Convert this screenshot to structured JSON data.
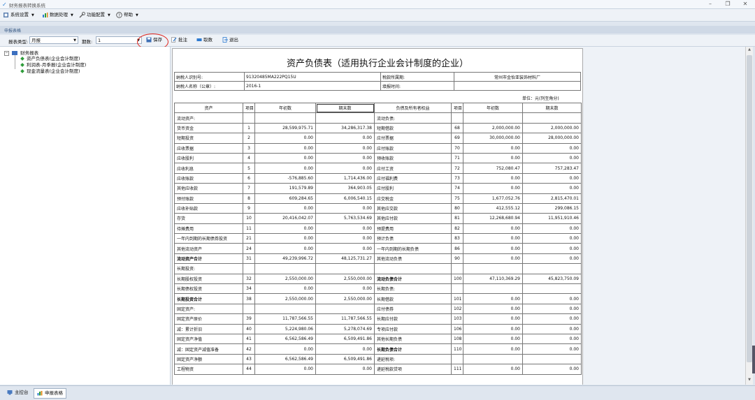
{
  "window": {
    "title": "财务报表转换系统"
  },
  "menu": [
    {
      "label": "系统设置",
      "icon": "settings-icon"
    },
    {
      "label": "数据处理",
      "icon": "data-icon"
    },
    {
      "label": "功能配置",
      "icon": "tools-icon"
    },
    {
      "label": "帮助",
      "icon": "help-icon"
    }
  ],
  "tab_strip": {
    "label": "申报表格"
  },
  "toolbar": {
    "report_type_label": "报表类型:",
    "report_type_value": "月报",
    "period_label": "期数:",
    "period_value": "1",
    "save_label": "保存",
    "annotate_label": "批注",
    "fetch_label": "取数",
    "exit_label": "退出"
  },
  "tree": {
    "root": "财务报表",
    "items": [
      "资产负债表(企业会计制度)",
      "利润表-月季报(企业会计制度)",
      "现金流量表(企业会计制度)"
    ]
  },
  "sheet": {
    "title": "资产负债表（适用执行企业会计制度的企业）",
    "taxpayer_id_label": "纳税人识别号:",
    "taxpayer_id": "91320485MA222PQ15U",
    "tax_office_label": "税款所属期:",
    "tax_office_value": "常州市金怡亚装饰材料厂",
    "taxpayer_name_label": "纳税人名称（公章）:",
    "taxpayer_name": "2016-1",
    "fill_date_label": "填报时间:",
    "unit": "单位：元(列至角分)",
    "headers": [
      "资产",
      "项目",
      "年初数",
      "期末数",
      "负债及所有者权益",
      "项目",
      "年初数",
      "期末数"
    ],
    "rows": [
      [
        "流动资产:",
        "",
        "",
        "",
        "流动负债:",
        "",
        "",
        ""
      ],
      [
        "货币资金",
        "1",
        "28,599,975.71",
        "34,286,317.38",
        "短期借款",
        "68",
        "2,000,000.00",
        "2,000,000.00"
      ],
      [
        "短期投资",
        "2",
        "0.00",
        "0.00",
        "应付票据",
        "69",
        "30,000,000.00",
        "28,000,000.00"
      ],
      [
        "应收票据",
        "3",
        "0.00",
        "0.00",
        "应付账款",
        "70",
        "0.00",
        "0.00"
      ],
      [
        "应收股利",
        "4",
        "0.00",
        "0.00",
        "预收账款",
        "71",
        "0.00",
        "0.00"
      ],
      [
        "应收利息",
        "5",
        "0.00",
        "0.00",
        "应付工资",
        "72",
        "752,080.47",
        "757,283.47"
      ],
      [
        "应收账款",
        "6",
        "-576,885.60",
        "1,714,436.00",
        "应付福利费",
        "73",
        "0.00",
        "0.00"
      ],
      [
        "其他应收款",
        "7",
        "191,579.89",
        "364,903.05",
        "应付股利",
        "74",
        "0.00",
        "0.00"
      ],
      [
        "预付账款",
        "8",
        "609,284.65",
        "6,006,540.15",
        "应交税金",
        "75",
        "1,677,052.76",
        "2,815,470.01"
      ],
      [
        "应收补贴款",
        "9",
        "0.00",
        "0.00",
        "其他应交款",
        "80",
        "412,555.12",
        "299,086.15"
      ],
      [
        "存货",
        "10",
        "20,416,042.07",
        "5,763,534.69",
        "其他应付款",
        "81",
        "12,268,680.94",
        "11,951,910.46"
      ],
      [
        "待摊费用",
        "11",
        "0.00",
        "0.00",
        "预提费用",
        "82",
        "0.00",
        "0.00"
      ],
      [
        "一年内到期的长期债券投资",
        "21",
        "0.00",
        "0.00",
        "预计负债",
        "83",
        "0.00",
        "0.00"
      ],
      [
        "其他流动资产",
        "24",
        "0.00",
        "0.00",
        "一年内到期的长期负债",
        "86",
        "0.00",
        "0.00"
      ],
      [
        "流动资产合计",
        "31",
        "49,239,996.72",
        "48,125,731.27",
        "其他流动负债",
        "90",
        "0.00",
        "0.00"
      ],
      [
        "长期投资:",
        "",
        "",
        "",
        "",
        "",
        "",
        ""
      ],
      [
        "长期股权投资",
        "32",
        "2,550,000.00",
        "2,550,000.00",
        "流动负债合计",
        "100",
        "47,110,369.29",
        "45,823,750.09"
      ],
      [
        "长期债权投资",
        "34",
        "0.00",
        "0.00",
        "长期负债:",
        "",
        "",
        ""
      ],
      [
        "长期投资合计",
        "38",
        "2,550,000.00",
        "2,550,000.00",
        "长期借款",
        "101",
        "0.00",
        "0.00"
      ],
      [
        "固定资产:",
        "",
        "",
        "",
        "应付债券",
        "102",
        "0.00",
        "0.00"
      ],
      [
        "固定资产原价",
        "39",
        "11,787,566.55",
        "11,787,566.55",
        "长期应付款",
        "103",
        "0.00",
        "0.00"
      ],
      [
        "减：累计折旧",
        "40",
        "5,224,980.06",
        "5,278,074.69",
        "专项应付款",
        "106",
        "0.00",
        "0.00"
      ],
      [
        "固定资产净值",
        "41",
        "6,562,586.49",
        "6,509,491.86",
        "其他长期负债",
        "108",
        "0.00",
        "0.00"
      ],
      [
        "减：固定资产减值准备",
        "42",
        "0.00",
        "0.00",
        "长期负债合计",
        "110",
        "0.00",
        "0.00"
      ],
      [
        "固定资产净额",
        "43",
        "6,562,586.49",
        "6,509,491.86",
        "递延税项:",
        "",
        "",
        ""
      ],
      [
        "工程物资",
        "44",
        "0.00",
        "0.00",
        "递延税款贷项",
        "111",
        "0.00",
        "0.00"
      ]
    ]
  },
  "status": {
    "tab_home": "主控台",
    "tab_report": "申报表格"
  },
  "colors": {
    "accent": "#2a7fd4",
    "highlight": "#e0241c"
  }
}
